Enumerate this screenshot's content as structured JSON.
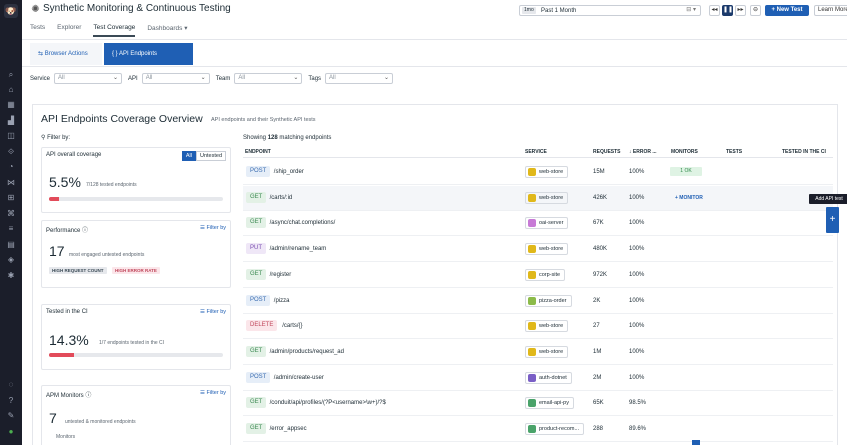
{
  "app": {
    "title": "Synthetic Monitoring & Continuous Testing"
  },
  "nav": {
    "tabs": [
      "Tests",
      "Explorer",
      "Test Coverage",
      "Dashboards"
    ],
    "dashboards_suffix": "▾"
  },
  "time": {
    "badge": "1mo",
    "value": "Past 1 Month"
  },
  "header": {
    "new_test": "+ New Test",
    "learn_more": "Learn More ▾"
  },
  "subtabs": {
    "browser": "Browser Actions",
    "api": "API Endpoints"
  },
  "filters": [
    {
      "label": "Service",
      "value": "All"
    },
    {
      "label": "API",
      "value": "All"
    },
    {
      "label": "Team",
      "value": "All"
    },
    {
      "label": "Tags",
      "value": "All"
    }
  ],
  "overview": {
    "title": "API Endpoints Coverage Overview",
    "subtitle": "API endpoints and their Synthetic API tests",
    "filter_by": "Filter by:"
  },
  "cards": {
    "coverage": {
      "title": "API overall coverage",
      "seg_all": "All",
      "seg_untested": "Untested",
      "value": "5.5%",
      "desc": "7/128 tested endpoints",
      "fraction": 0.055
    },
    "performance": {
      "title": "Performance",
      "filter": "Filter by",
      "value": "17",
      "desc": "most engaged untested endpoints",
      "tag1": "HIGH REQUEST COUNT",
      "tag2": "HIGH ERROR RATE"
    },
    "ci": {
      "title": "Tested in the CI",
      "filter": "Filter by",
      "value": "14.3%",
      "desc": "1/7 endpoints tested in the CI",
      "fraction": 0.143
    },
    "apm": {
      "title": "APM Monitors",
      "filter": "Filter by",
      "value": "7",
      "desc": "untested & monitored endpoints",
      "more": "Monitors"
    }
  },
  "table": {
    "showing_prefix": "Showing ",
    "showing_count": "128",
    "showing_suffix": " matching endpoints",
    "headers": {
      "endpoint": "ENDPOINT",
      "service": "SERVICE",
      "requests": "REQUESTS",
      "error": "↓  ERROR ...",
      "monitors": "MONITORS",
      "tests": "TESTS",
      "ci": "TESTED IN THE CI"
    },
    "rows": [
      {
        "method": "POST",
        "path": "/ship_order",
        "service": "web-store",
        "requests": "15M",
        "error": "100%",
        "monitors": "1 OK"
      },
      {
        "method": "GET",
        "path": "/carts/:id",
        "service": "web-store",
        "requests": "426K",
        "error": "100%",
        "monitors": "+ MONITOR"
      },
      {
        "method": "GET",
        "path": "/async/chat.completions/",
        "service": "oai-server",
        "requests": "67K",
        "error": "100%",
        "monitors": ""
      },
      {
        "method": "PUT",
        "path": "/admin/rename_team",
        "service": "web-store",
        "requests": "480K",
        "error": "100%",
        "monitors": ""
      },
      {
        "method": "GET",
        "path": "/register",
        "service": "corp-site",
        "requests": "972K",
        "error": "100%",
        "monitors": ""
      },
      {
        "method": "POST",
        "path": "/pizza",
        "service": "pizza-order",
        "requests": "2K",
        "error": "100%",
        "monitors": ""
      },
      {
        "method": "DELETE",
        "path": "/carts/{}",
        "service": "web-store",
        "requests": "27",
        "error": "100%",
        "monitors": ""
      },
      {
        "method": "GET",
        "path": "/admin/products/request_ad",
        "service": "web-store",
        "requests": "1M",
        "error": "100%",
        "monitors": ""
      },
      {
        "method": "POST",
        "path": "/admin/create-user",
        "service": "auth-dotnet",
        "requests": "2M",
        "error": "100%",
        "monitors": ""
      },
      {
        "method": "GET",
        "path": "/conduit/api/profiles/(?P<username>\\w+)/?$",
        "service": "email-api-py",
        "requests": "65K",
        "error": "98.5%",
        "monitors": ""
      },
      {
        "method": "GET",
        "path": "/error_appsec",
        "service": "product-recom...",
        "requests": "288",
        "error": "89.6%",
        "monitors": ""
      }
    ],
    "add_test_tooltip": "Add API test",
    "add_test_icon": "+"
  },
  "colors": {
    "accent": "#1f5fb4",
    "error_bar": "#e24b5a"
  }
}
